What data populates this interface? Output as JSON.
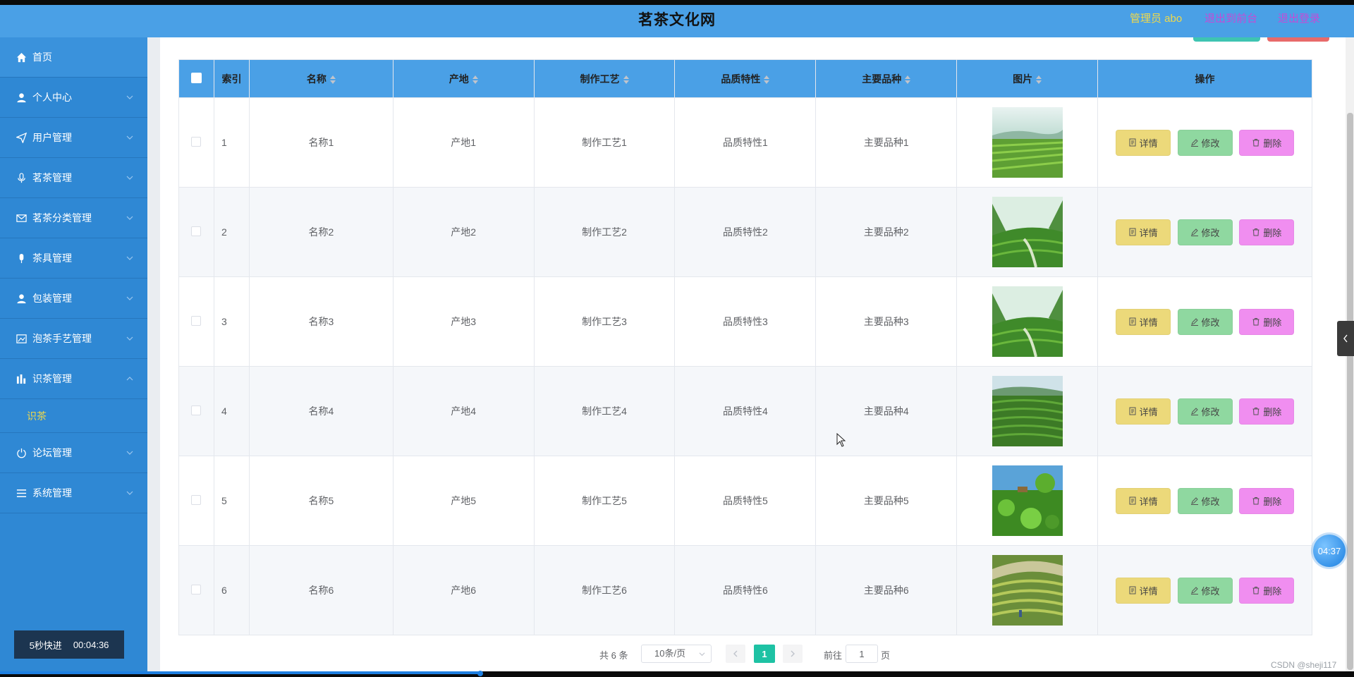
{
  "header": {
    "site_title": "茗茶文化网",
    "admin_label": "管理员 abo",
    "to_front": "退出到前台",
    "logout": "退出登录"
  },
  "sidebar": {
    "items": [
      {
        "label": "首页",
        "icon": "home-icon"
      },
      {
        "label": "个人中心",
        "icon": "user-icon"
      },
      {
        "label": "用户管理",
        "icon": "send-icon"
      },
      {
        "label": "茗茶管理",
        "icon": "microphone-icon"
      },
      {
        "label": "茗茶分类管理",
        "icon": "mail-icon"
      },
      {
        "label": "茶具管理",
        "icon": "mic-icon"
      },
      {
        "label": "包装管理",
        "icon": "user-icon"
      },
      {
        "label": "泡茶手艺管理",
        "icon": "image-icon"
      },
      {
        "label": "识茶管理",
        "icon": "chart-icon"
      },
      {
        "label": "论坛管理",
        "icon": "power-icon"
      },
      {
        "label": "系统管理",
        "icon": "menu-icon"
      }
    ],
    "sub_item": "识茶"
  },
  "player": {
    "speed_label": "5秒快进",
    "elapsed": "00:04:36",
    "timer": "04:37"
  },
  "table": {
    "headers": [
      "索引",
      "名称",
      "产地",
      "制作工艺",
      "品质特性",
      "主要品种",
      "图片",
      "操作"
    ],
    "rows": [
      {
        "index": "1",
        "name": "名称1",
        "origin": "产地1",
        "craft": "制作工艺1",
        "quality": "品质特性1",
        "variety": "主要品种1"
      },
      {
        "index": "2",
        "name": "名称2",
        "origin": "产地2",
        "craft": "制作工艺2",
        "quality": "品质特性2",
        "variety": "主要品种2"
      },
      {
        "index": "3",
        "name": "名称3",
        "origin": "产地3",
        "craft": "制作工艺3",
        "quality": "品质特性3",
        "variety": "主要品种3"
      },
      {
        "index": "4",
        "name": "名称4",
        "origin": "产地4",
        "craft": "制作工艺4",
        "quality": "品质特性4",
        "variety": "主要品种4"
      },
      {
        "index": "5",
        "name": "名称5",
        "origin": "产地5",
        "craft": "制作工艺5",
        "quality": "品质特性5",
        "variety": "主要品种5"
      },
      {
        "index": "6",
        "name": "名称6",
        "origin": "产地6",
        "craft": "制作工艺6",
        "quality": "品质特性6",
        "variety": "主要品种6"
      }
    ],
    "actions": {
      "detail": "详情",
      "edit": "修改",
      "delete": "删除"
    }
  },
  "pagination": {
    "total": "共 6 条",
    "page_size": "10条/页",
    "current_page": "1",
    "goto_label": "前往",
    "goto_value": "1",
    "page_suffix": "页"
  },
  "watermark": "CSDN @sheji117",
  "colors": {
    "header_bg": "#4aa0e6",
    "sidebar_bg": "#2f88d4",
    "active_sub": "#f1d94a",
    "detail_btn": "#ecd97a",
    "edit_btn": "#8fd8a0",
    "delete_btn": "#f08ef0",
    "pager_active": "#1ec2a4"
  }
}
